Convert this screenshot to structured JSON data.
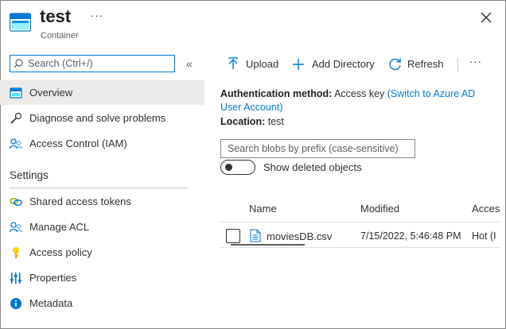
{
  "header": {
    "title": "test",
    "subtitle": "Container",
    "more_label": "···",
    "icon": "container-icon",
    "close_icon": "close-icon"
  },
  "sidebar": {
    "search_placeholder": "Search (Ctrl+/)",
    "collapse_label": "«",
    "items": [
      {
        "label": "Overview",
        "icon": "overview-icon"
      },
      {
        "label": "Diagnose and solve problems",
        "icon": "wrench-icon"
      },
      {
        "label": "Access Control (IAM)",
        "icon": "people-icon"
      }
    ],
    "settings_title": "Settings",
    "settings_items": [
      {
        "label": "Shared access tokens",
        "icon": "link-icon"
      },
      {
        "label": "Manage ACL",
        "icon": "people-icon"
      },
      {
        "label": "Access policy",
        "icon": "key-icon"
      },
      {
        "label": "Properties",
        "icon": "sliders-icon"
      },
      {
        "label": "Metadata",
        "icon": "info-icon"
      }
    ]
  },
  "toolbar": {
    "upload_label": "Upload",
    "add_directory_label": "Add Directory",
    "refresh_label": "Refresh",
    "more_label": "···"
  },
  "info": {
    "auth_label": "Authentication method:",
    "auth_value": "Access key",
    "auth_link_1": "(Switch to Azure AD",
    "auth_link_2": "User Account)",
    "location_label": "Location:",
    "location_value": "test"
  },
  "filter": {
    "prefix_placeholder": "Search blobs by prefix (case-sensitive)",
    "show_deleted_label": "Show deleted objects",
    "show_deleted_on": false
  },
  "table": {
    "columns": [
      "Name",
      "Modified",
      "Acces"
    ],
    "rows": [
      {
        "name": "moviesDB.csv",
        "modified": "7/15/2022, 5:46:48 PM",
        "access": "Hot (I"
      }
    ]
  },
  "colors": {
    "accent": "#0078d4",
    "active_bg": "#edebe9",
    "text": "#323130"
  }
}
